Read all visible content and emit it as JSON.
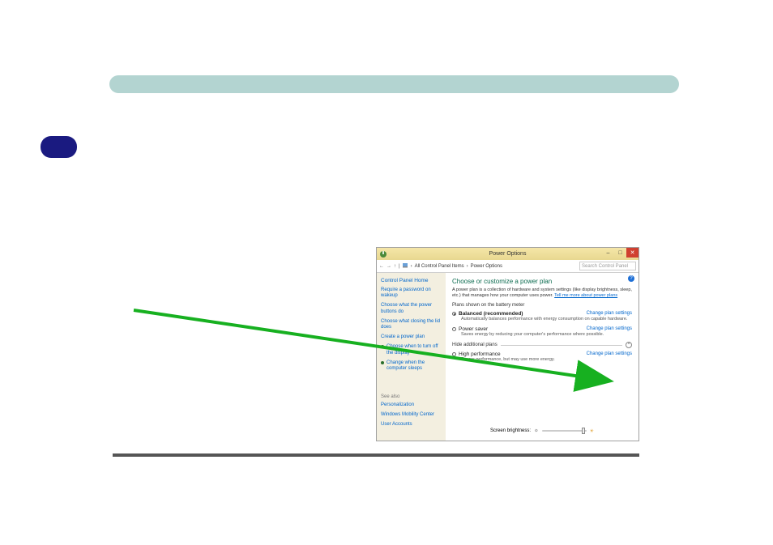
{
  "window": {
    "title": "Power Options",
    "nav": {
      "back": "←",
      "fwd": "→",
      "up": "↑",
      "path_sep": "›",
      "crumb1": "All Control Panel Items",
      "crumb2": "Power Options",
      "search_placeholder": "Search Control Panel"
    },
    "sidebar": {
      "home": "Control Panel Home",
      "items": [
        "Require a password on wakeup",
        "Choose what the power buttons do",
        "Choose what closing the lid does",
        "Create a power plan",
        "Choose when to turn off the display",
        "Change when the computer sleeps"
      ],
      "seealso_label": "See also",
      "seealso": [
        "Personalization",
        "Windows Mobility Center",
        "User Accounts"
      ]
    },
    "main": {
      "heading": "Choose or customize a power plan",
      "desc_pre": "A power plan is a collection of hardware and system settings (like display brightness, sleep, etc.) that manages how your computer uses power. ",
      "desc_link": "Tell me more about power plans",
      "section1": "Plans shown on the battery meter",
      "plans": [
        {
          "name": "Balanced (recommended)",
          "desc": "Automatically balances performance with energy consumption on capable hardware.",
          "checked": true
        },
        {
          "name": "Power saver",
          "desc": "Saves energy by reducing your computer's performance where possible.",
          "checked": false
        }
      ],
      "hide_label": "Hide additional plans",
      "plans2": [
        {
          "name": "High performance",
          "desc": "Favors performance, but may use more energy.",
          "checked": false
        }
      ],
      "change_link": "Change plan settings",
      "brightness_label": "Screen brightness:",
      "help": "?"
    },
    "winbtns": {
      "min": "–",
      "max": "□",
      "close": "✕"
    }
  }
}
